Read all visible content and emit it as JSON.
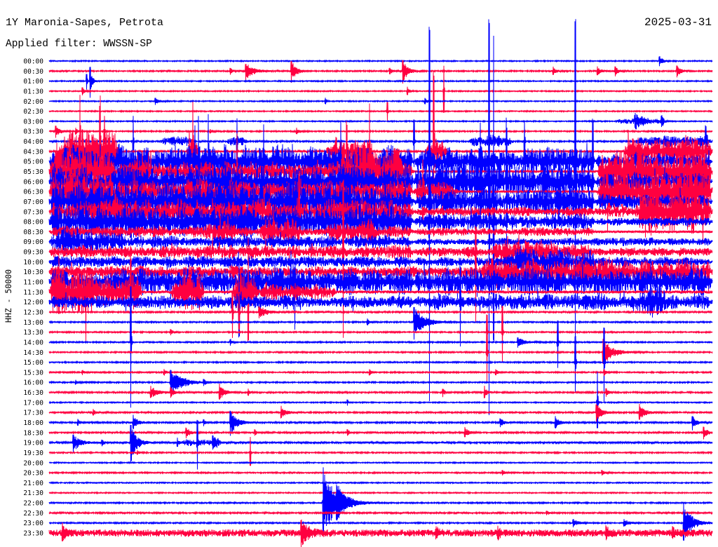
{
  "chart_data": {
    "type": "line",
    "title": "1Y Maronia-Sapes, Petrota",
    "date": "2025-03-31",
    "subtitle": "Applied filter: WWSSN-SP",
    "xlabel": "",
    "ylabel": "HHZ - 50000",
    "grid": false,
    "trace_colors": [
      "#0000ff",
      "#ff0040"
    ],
    "rows": [
      {
        "time": "00:00",
        "noise": 0.06,
        "events": [
          [
            27.6,
            0.4,
            0.5
          ]
        ]
      },
      {
        "time": "00:30",
        "noise": 0.07,
        "events": [
          [
            8.2,
            0.3,
            0.3
          ],
          [
            8.9,
            1.0,
            0.8
          ],
          [
            10.95,
            0.6,
            1.1
          ],
          [
            15.4,
            0.4,
            0.3
          ],
          [
            16.0,
            0.6,
            1.2
          ],
          [
            22.8,
            0.4,
            0.4
          ],
          [
            24.8,
            0.5,
            0.4
          ],
          [
            25.6,
            0.4,
            0.5
          ],
          [
            28.4,
            0.5,
            0.6
          ]
        ]
      },
      {
        "time": "01:00",
        "noise": 0.06,
        "events": [
          [
            1.7,
            0.1,
            0.8
          ],
          [
            1.85,
            0.25,
            1.6
          ]
        ]
      },
      {
        "time": "01:30",
        "noise": 0.06,
        "events": [
          [
            1.5,
            0.3,
            0.4
          ],
          [
            16.2,
            0.3,
            0.4
          ],
          [
            17.85,
            0.03,
            2.5
          ]
        ]
      },
      {
        "time": "02:00",
        "noise": 0.06,
        "events": [
          [
            4.8,
            0.5,
            0.35
          ],
          [
            12.5,
            0.2,
            0.3
          ],
          [
            17.0,
            0.3,
            0.3
          ]
        ]
      },
      {
        "time": "02:30",
        "noise": 0.06,
        "events": [
          [
            15.3,
            0.05,
            1.0
          ]
        ]
      },
      {
        "time": "03:00",
        "noise": 0.06,
        "envelope": [
          [
            25.6,
            27.9,
            0.35
          ]
        ],
        "events": [
          [
            26.5,
            0.8,
            0.6
          ],
          [
            27.7,
            0.3,
            0.5
          ]
        ]
      },
      {
        "time": "03:30",
        "noise": 0.07,
        "events": [
          [
            0.3,
            0.5,
            0.6
          ],
          [
            1.2,
            0.3,
            0.3
          ],
          [
            2.5,
            0.05,
            1.5
          ],
          [
            7.3,
            0.3,
            0.2
          ],
          [
            11.2,
            0.4,
            0.3
          ]
        ]
      },
      {
        "time": "04:00",
        "noise": 0.08,
        "envelope": [
          [
            5.0,
            6.5,
            0.6
          ],
          [
            8.0,
            9.0,
            0.5
          ],
          [
            19.0,
            21.0,
            0.7
          ],
          [
            26.5,
            30.0,
            0.6
          ]
        ],
        "events": [
          [
            3.8,
            0.04,
            2.5
          ],
          [
            8.5,
            0.05,
            2.0
          ],
          [
            16.5,
            0.05,
            2.5
          ],
          [
            21.5,
            0.05,
            2.0
          ],
          [
            29.7,
            0.1,
            1.2
          ]
        ]
      },
      {
        "time": "04:30",
        "noise": 0.1,
        "envelope": [
          [
            0.5,
            3.2,
            2.6
          ],
          [
            6.2,
            6.8,
            2.0
          ],
          [
            12.5,
            14.6,
            1.5
          ],
          [
            17.0,
            18.0,
            1.5
          ],
          [
            26.0,
            30.0,
            1.6
          ]
        ],
        "events": [
          [
            1.4,
            0.05,
            5.0
          ],
          [
            2.3,
            0.05,
            4.8
          ],
          [
            6.5,
            0.05,
            4.0
          ],
          [
            17.4,
            0.04,
            8.0
          ]
        ]
      },
      {
        "time": "05:00",
        "noise": 0.15,
        "envelope": [
          [
            0,
            16.5,
            1.7
          ],
          [
            16.5,
            24.7,
            1.5
          ],
          [
            24.7,
            30,
            0.8
          ]
        ],
        "events": [
          [
            6.75,
            0.04,
            3.0
          ],
          [
            7.2,
            0.05,
            3.5
          ],
          [
            9.7,
            0.05,
            2.5
          ],
          [
            13.2,
            0.05,
            3.0
          ],
          [
            19.5,
            0.05,
            3.0
          ],
          [
            24.6,
            0.05,
            4.0
          ]
        ]
      },
      {
        "time": "05:30",
        "noise": 0.12,
        "envelope": [
          [
            0,
            3,
            3.0
          ],
          [
            3,
            16.5,
            1.2
          ],
          [
            13,
            16,
            2.3
          ],
          [
            24.8,
            30,
            2.3
          ]
        ],
        "events": [
          [
            8.5,
            0.05,
            3.0
          ],
          [
            14.5,
            0.05,
            4.0
          ]
        ]
      },
      {
        "time": "06:00",
        "noise": 0.15,
        "envelope": [
          [
            0,
            16.5,
            1.9
          ],
          [
            16.5,
            24.7,
            1.8
          ],
          [
            24.7,
            30,
            1.0
          ]
        ],
        "events": [
          [
            20.7,
            0.04,
            6.0
          ],
          [
            23.8,
            0.04,
            18.0
          ]
        ]
      },
      {
        "time": "06:30",
        "noise": 0.12,
        "envelope": [
          [
            0,
            3,
            2.5
          ],
          [
            3,
            16.5,
            1.3
          ],
          [
            16.5,
            18.5,
            1.2
          ],
          [
            24.8,
            30,
            2.4
          ]
        ],
        "events": [
          [
            16.9,
            0.05,
            3.0
          ]
        ]
      },
      {
        "time": "07:00",
        "noise": 0.15,
        "envelope": [
          [
            0,
            16.5,
            2.2
          ],
          [
            16.5,
            24.7,
            1.4
          ],
          [
            24.7,
            30,
            0.7
          ]
        ],
        "events": [
          [
            17.2,
            0.04,
            19.5
          ],
          [
            19.9,
            0.04,
            20.5
          ],
          [
            20.1,
            0.04,
            16.0
          ]
        ]
      },
      {
        "time": "07:30",
        "noise": 0.12,
        "envelope": [
          [
            0,
            16.5,
            1.3
          ],
          [
            16.5,
            30,
            0.45
          ],
          [
            26.5,
            30,
            2.2
          ]
        ],
        "events": [
          [
            3.0,
            0.4,
            1.0
          ],
          [
            11.3,
            0.05,
            4.0
          ]
        ]
      },
      {
        "time": "08:00",
        "noise": 0.15,
        "envelope": [
          [
            0,
            16.5,
            1.8
          ],
          [
            16.5,
            24.7,
            0.8
          ],
          [
            24.7,
            30,
            0.35
          ]
        ]
      },
      {
        "time": "08:30",
        "noise": 0.12,
        "envelope": [
          [
            0,
            16.5,
            0.5
          ],
          [
            7.0,
            8.5,
            0.9
          ],
          [
            9.5,
            11.5,
            0.8
          ],
          [
            12.5,
            14.8,
            0.9
          ],
          [
            16.5,
            24.7,
            0.35
          ]
        ]
      },
      {
        "time": "09:00",
        "noise": 0.12,
        "envelope": [
          [
            0,
            3.5,
            1.0
          ],
          [
            0,
            16.5,
            0.6
          ],
          [
            16.5,
            30,
            0.35
          ]
        ]
      },
      {
        "time": "09:30",
        "noise": 0.15,
        "envelope": [
          [
            0,
            16.5,
            0.6
          ],
          [
            16.5,
            30,
            0.4
          ],
          [
            20,
            24.5,
            0.9
          ]
        ],
        "events": [
          [
            13.3,
            0.04,
            8.0
          ]
        ]
      },
      {
        "time": "10:00",
        "noise": 0.12,
        "envelope": [
          [
            0,
            16.5,
            0.55
          ],
          [
            16.5,
            30,
            0.45
          ],
          [
            20.5,
            24.8,
            0.9
          ]
        ]
      },
      {
        "time": "10:30",
        "noise": 0.15,
        "envelope": [
          [
            0,
            9,
            0.6
          ],
          [
            9,
            19.4,
            0.45
          ],
          [
            19.4,
            30,
            1.5
          ]
        ],
        "events": [
          [
            19.3,
            0.04,
            5.0
          ]
        ]
      },
      {
        "time": "11:00",
        "noise": 0.2,
        "envelope": [
          [
            0,
            16.5,
            1.3
          ],
          [
            10,
            11.5,
            1.5
          ],
          [
            16.5,
            30,
            1.4
          ]
        ]
      },
      {
        "time": "11:30",
        "noise": 0.15,
        "envelope": [
          [
            0,
            4.2,
            2.5
          ],
          [
            5.5,
            7.0,
            2.1
          ],
          [
            8.3,
            9.5,
            2.4
          ],
          [
            9.5,
            13,
            0.8
          ]
        ],
        "events": [
          [
            3.7,
            0.05,
            3.5
          ],
          [
            9.0,
            0.05,
            4.0
          ]
        ]
      },
      {
        "time": "12:00",
        "noise": 0.15,
        "envelope": [
          [
            0,
            16.5,
            0.6
          ],
          [
            16.5,
            30,
            0.8
          ],
          [
            26.5,
            28,
            1.5
          ]
        ],
        "events": [
          [
            8.6,
            0.05,
            3.5
          ],
          [
            18.6,
            0.05,
            4.0
          ]
        ]
      },
      {
        "time": "12:30",
        "noise": 0.08,
        "events": [
          [
            8.3,
            0.05,
            2.5
          ],
          [
            8.6,
            0.05,
            2.0
          ],
          [
            9.5,
            1.0,
            0.6
          ]
        ]
      },
      {
        "time": "13:00",
        "noise": 0.07,
        "events": [
          [
            14.4,
            0.3,
            0.3
          ],
          [
            16.5,
            1.2,
            1.7
          ]
        ]
      },
      {
        "time": "13:30",
        "noise": 0.07,
        "events": [
          [
            5.5,
            0.3,
            0.3
          ],
          [
            19.8,
            0.05,
            2.0
          ],
          [
            20.5,
            0.05,
            3.0
          ]
        ]
      },
      {
        "time": "14:00",
        "noise": 0.07,
        "events": [
          [
            3.7,
            0.04,
            6.5
          ],
          [
            8.2,
            0.2,
            0.3
          ],
          [
            21.2,
            0.8,
            0.5
          ],
          [
            23.0,
            0.04,
            2.5
          ]
        ]
      },
      {
        "time": "14:30",
        "noise": 0.07,
        "events": [
          [
            19.8,
            0.05,
            3.0
          ],
          [
            25.05,
            1.2,
            1.3
          ]
        ]
      },
      {
        "time": "15:00",
        "noise": 0.07,
        "events": [
          [
            23.8,
            0.04,
            3.0
          ],
          [
            25.1,
            0.04,
            4.0
          ]
        ]
      },
      {
        "time": "15:30",
        "noise": 0.07,
        "events": [
          [
            1.5,
            0.3,
            0.2
          ],
          [
            5.2,
            0.3,
            0.3
          ],
          [
            14.5,
            0.3,
            0.3
          ],
          [
            20.2,
            0.3,
            0.3
          ],
          [
            25.1,
            0.3,
            0.3
          ]
        ]
      },
      {
        "time": "16:00",
        "noise": 0.07,
        "events": [
          [
            1.2,
            0.3,
            0.2
          ],
          [
            5.5,
            1.4,
            1.4
          ],
          [
            7.0,
            0.3,
            0.3
          ]
        ]
      },
      {
        "time": "16:30",
        "noise": 0.08,
        "events": [
          [
            4.6,
            0.8,
            0.6
          ],
          [
            5.5,
            0.4,
            0.5
          ],
          [
            7.7,
            0.6,
            0.8
          ],
          [
            9.0,
            0.3,
            0.3
          ],
          [
            17.8,
            0.3,
            0.4
          ],
          [
            19.7,
            0.3,
            0.6
          ],
          [
            25.2,
            0.3,
            0.4
          ]
        ]
      },
      {
        "time": "17:00",
        "noise": 0.06,
        "events": [
          [
            13.5,
            0.05,
            0.3
          ],
          [
            24.8,
            0.04,
            3.0
          ]
        ]
      },
      {
        "time": "17:30",
        "noise": 0.08,
        "events": [
          [
            2.0,
            0.3,
            0.3
          ],
          [
            10.5,
            0.6,
            0.6
          ],
          [
            24.75,
            0.7,
            0.9
          ],
          [
            26.7,
            0.7,
            0.8
          ]
        ]
      },
      {
        "time": "18:00",
        "noise": 0.08,
        "events": [
          [
            1.3,
            0.3,
            0.3
          ],
          [
            3.8,
            0.6,
            0.7
          ],
          [
            7.0,
            0.3,
            0.3
          ],
          [
            8.2,
            0.8,
            1.3
          ],
          [
            20.4,
            0.5,
            0.4
          ],
          [
            22.9,
            0.5,
            0.6
          ],
          [
            29.1,
            0.5,
            0.7
          ]
        ]
      },
      {
        "time": "18:30",
        "noise": 0.08,
        "events": [
          [
            6.2,
            0.5,
            0.5
          ],
          [
            9.3,
            0.3,
            0.3
          ],
          [
            13.5,
            0.3,
            0.3
          ],
          [
            18.8,
            0.5,
            0.5
          ],
          [
            29.6,
            0.5,
            0.6
          ]
        ]
      },
      {
        "time": "19:00",
        "noise": 0.09,
        "envelope": [
          [
            6.0,
            7.8,
            0.35
          ]
        ],
        "events": [
          [
            1.1,
            0.8,
            0.9
          ],
          [
            2.4,
            0.3,
            0.3
          ],
          [
            3.7,
            0.7,
            2.0
          ],
          [
            5.8,
            0.3,
            0.4
          ],
          [
            6.7,
            0.05,
            2.5
          ],
          [
            7.4,
            0.4,
            0.6
          ]
        ]
      },
      {
        "time": "19:30",
        "noise": 0.07,
        "events": [
          [
            4.0,
            0.3,
            0.2
          ],
          [
            9.1,
            0.04,
            1.5
          ]
        ]
      },
      {
        "time": "20:00",
        "noise": 0.06
      },
      {
        "time": "20:30",
        "noise": 0.07,
        "events": [
          [
            20.5,
            0.4,
            0.25
          ],
          [
            25.0,
            0.4,
            0.25
          ]
        ]
      },
      {
        "time": "21:00",
        "noise": 0.06
      },
      {
        "time": "21:30",
        "noise": 0.06
      },
      {
        "time": "22:00",
        "noise": 0.07,
        "events": [
          [
            12.4,
            1.6,
            3.5
          ],
          [
            13.0,
            0.8,
            1.2
          ]
        ]
      },
      {
        "time": "22:30",
        "noise": 0.08,
        "events": [
          [
            22.5,
            0.4,
            0.2
          ]
        ]
      },
      {
        "time": "23:00",
        "noise": 0.07,
        "events": [
          [
            23.7,
            0.6,
            0.4
          ],
          [
            26.0,
            0.6,
            0.35
          ],
          [
            28.7,
            1.0,
            2.0
          ]
        ]
      },
      {
        "time": "23:30",
        "noise": 0.28,
        "envelope": [
          [
            0,
            30,
            0.1
          ]
        ],
        "events": [
          [
            0.6,
            0.6,
            0.7
          ],
          [
            11.4,
            0.8,
            1.4
          ],
          [
            17.5,
            0.4,
            0.5
          ],
          [
            20.3,
            0.4,
            0.5
          ],
          [
            25.2,
            0.4,
            0.5
          ],
          [
            28.2,
            0.3,
            0.5
          ]
        ]
      }
    ]
  }
}
